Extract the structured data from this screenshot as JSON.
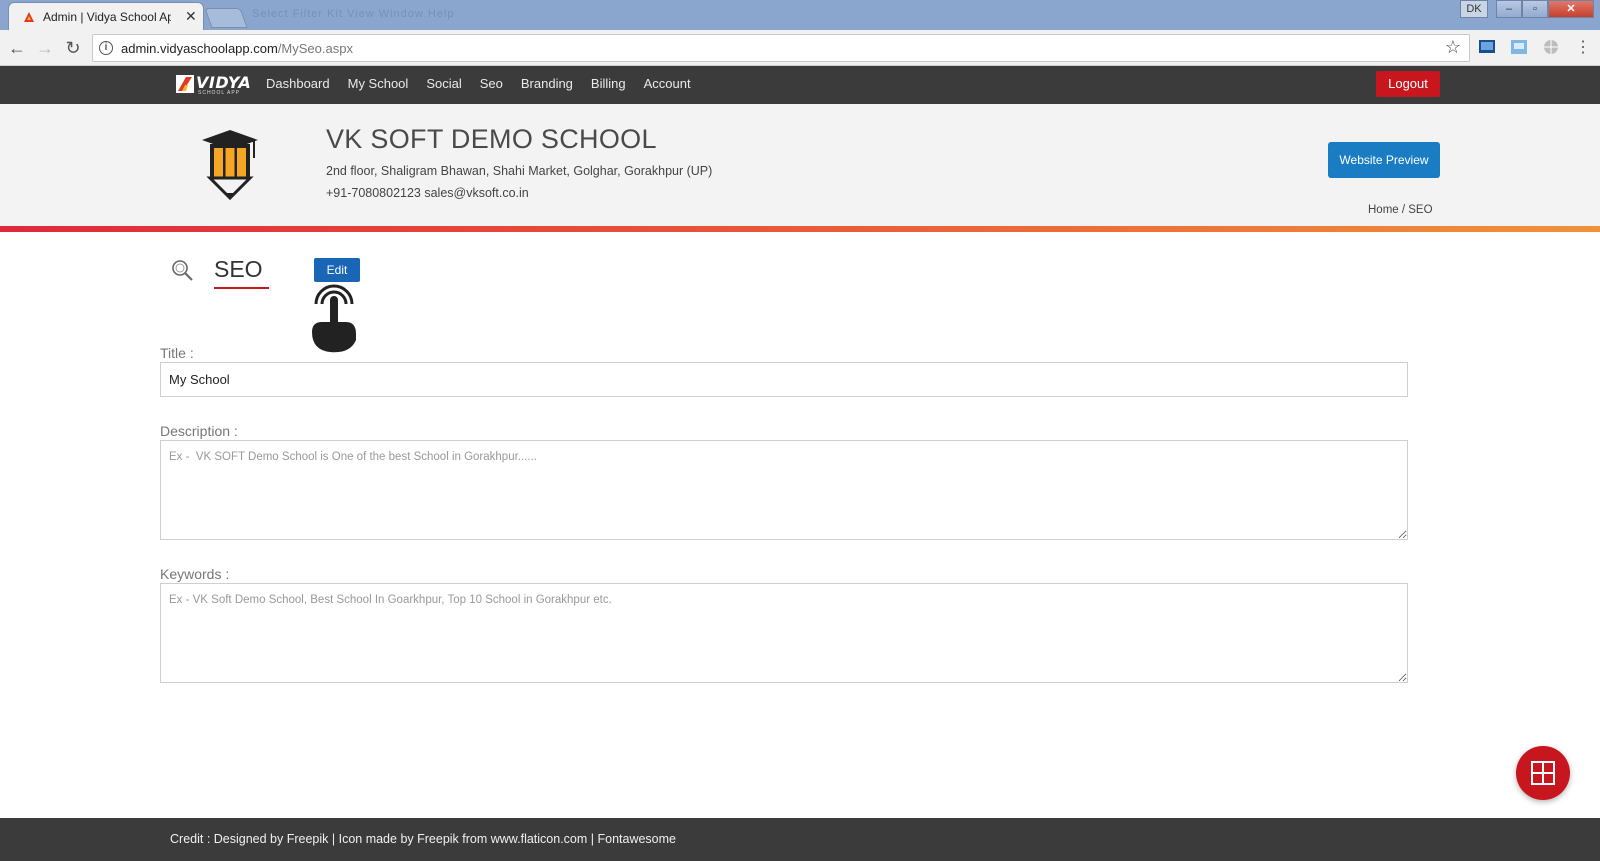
{
  "browser": {
    "tab_title": "Admin | Vidya School Ap",
    "tab_close": "✕",
    "url_host": "admin.vidyaschoolapp.com",
    "url_path": "/MySeo.aspx",
    "window_user": "DK",
    "blurred_menu": "Select  Filter  Kit  View  Window  Help"
  },
  "nav": {
    "logo_word": "VIDYA",
    "logo_sub": "SCHOOL APP",
    "items": [
      "Dashboard",
      "My School",
      "Social",
      "Seo",
      "Branding",
      "Billing",
      "Account"
    ],
    "logout": "Logout"
  },
  "school": {
    "name": "VK SOFT DEMO SCHOOL",
    "address": "2nd floor, Shaligram Bhawan, Shahi Market, Golghar, Gorakhpur (UP)",
    "contact": "+91-7080802123  sales@vksoft.co.in",
    "preview_button": "Website Preview",
    "breadcrumb": "Home / SEO"
  },
  "seo": {
    "heading": "SEO",
    "edit_button": "Edit",
    "title_label": "Title :",
    "title_value": "My School",
    "description_label": "Description :",
    "description_placeholder": "Ex -  VK SOFT Demo School is One of the best School in Gorakhpur......",
    "keywords_label": "Keywords :",
    "keywords_placeholder": "Ex - VK Soft Demo School, Best School In Goarkhpur, Top 10 School in Gorakhpur etc."
  },
  "footer": {
    "credit": "Credit : Designed by Freepik | Icon made by Freepik from www.flaticon.com | Fontawesome"
  },
  "colors": {
    "nav_bg": "#3b3b3b",
    "brand_red": "#c8161e",
    "primary_blue": "#1a7dc4",
    "header_bg": "#f4f3f4"
  }
}
